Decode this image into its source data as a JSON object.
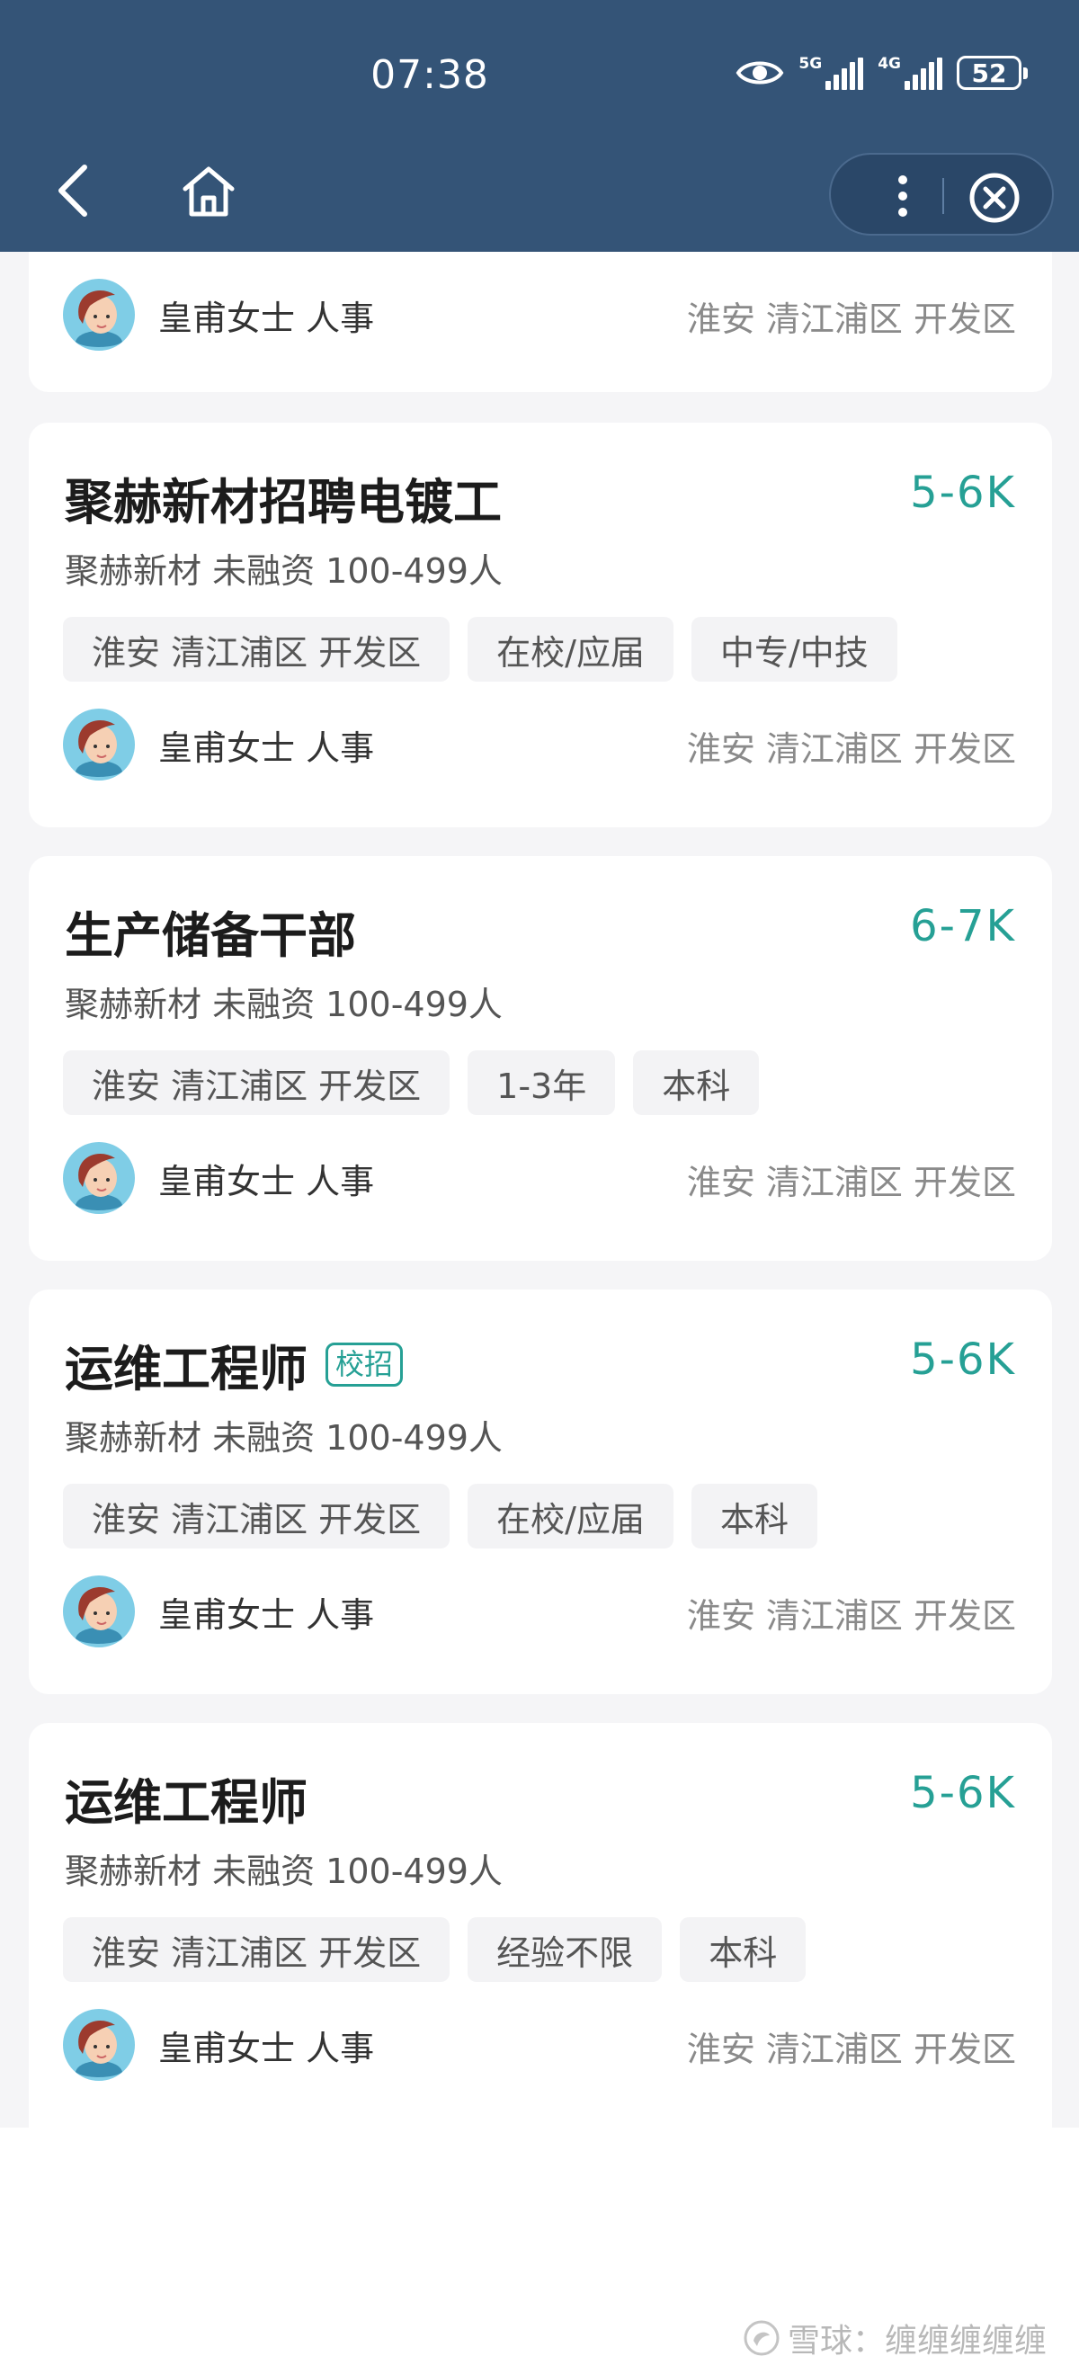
{
  "status_bar": {
    "time": "07:38",
    "net1": "5G",
    "net2": "4G",
    "battery": "52"
  },
  "icons": {
    "back": "back-arrow-icon",
    "home": "home-icon",
    "more": "more-vertical-icon",
    "close": "close-circle-icon",
    "eye": "eye-icon"
  },
  "colors": {
    "header_bg": "#345477",
    "accent": "#26a095",
    "page_bg": "#f5f5f7"
  },
  "partial_card": {
    "recruiter": "皇甫女士 人事",
    "location": "淮安 清江浦区 开发区"
  },
  "jobs": [
    {
      "title": "聚赫新材招聘电镀工",
      "badge": "",
      "salary": "5-6K",
      "company": "聚赫新材 未融资 100-499人",
      "tags": [
        "淮安 清江浦区 开发区",
        "在校/应届",
        "中专/中技"
      ],
      "recruiter": "皇甫女士 人事",
      "location": "淮安 清江浦区 开发区"
    },
    {
      "title": "生产储备干部",
      "badge": "",
      "salary": "6-7K",
      "company": "聚赫新材 未融资 100-499人",
      "tags": [
        "淮安 清江浦区 开发区",
        "1-3年",
        "本科"
      ],
      "recruiter": "皇甫女士 人事",
      "location": "淮安 清江浦区 开发区"
    },
    {
      "title": "运维工程师",
      "badge": "校招",
      "salary": "5-6K",
      "company": "聚赫新材 未融资 100-499人",
      "tags": [
        "淮安 清江浦区 开发区",
        "在校/应届",
        "本科"
      ],
      "recruiter": "皇甫女士 人事",
      "location": "淮安 清江浦区 开发区"
    },
    {
      "title": "运维工程师",
      "badge": "",
      "salary": "5-6K",
      "company": "聚赫新材 未融资 100-499人",
      "tags": [
        "淮安 清江浦区 开发区",
        "经验不限",
        "本科"
      ],
      "recruiter": "皇甫女士 人事",
      "location": "淮安 清江浦区 开发区"
    }
  ],
  "watermark": "雪球：缠缠缠缠缠"
}
